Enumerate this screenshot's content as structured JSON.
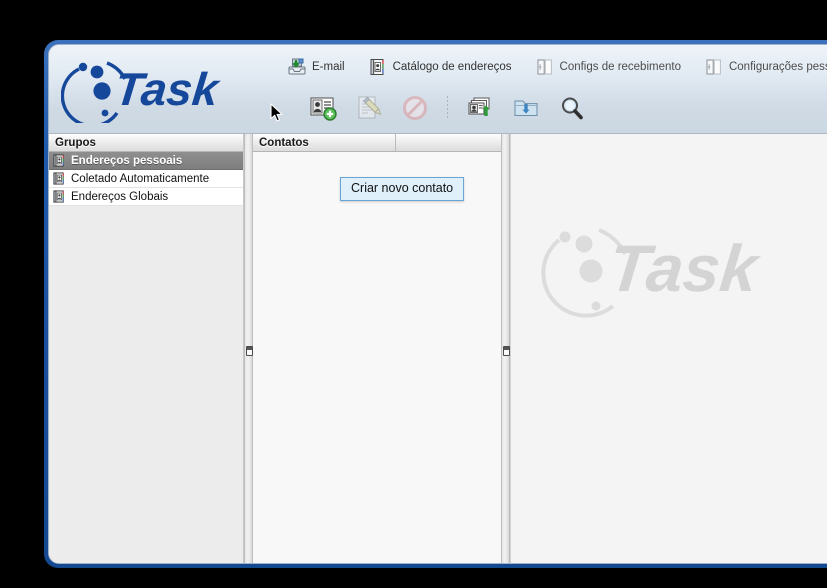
{
  "window": {
    "accent_color": "#1b4f9c",
    "brand": "Task"
  },
  "header": {
    "logo_text": "Task",
    "menu": [
      {
        "label": "E-mail",
        "icon": "inbox-download-icon",
        "state": "active"
      },
      {
        "label": "Catálogo de endereços",
        "icon": "address-book-icon",
        "state": "active"
      },
      {
        "label": "Configs de recebimento",
        "icon": "panel-icon",
        "state": "dim"
      },
      {
        "label": "Configurações pessoais",
        "icon": "panel-icon",
        "state": "dim"
      }
    ]
  },
  "toolbar": {
    "buttons": [
      {
        "name": "new-contact",
        "icon": "person-add-icon",
        "enabled": true,
        "tooltip": "Criar novo contato"
      },
      {
        "name": "edit-contact",
        "icon": "pencil-edit-icon",
        "enabled": false
      },
      {
        "name": "delete-contact",
        "icon": "prohibited-icon",
        "enabled": false
      },
      {
        "name": "import-contacts",
        "icon": "contacts-upload-icon",
        "enabled": true
      },
      {
        "name": "import-folder",
        "icon": "folder-download-icon",
        "enabled": true
      },
      {
        "name": "search",
        "icon": "magnifier-icon",
        "enabled": true
      }
    ]
  },
  "tooltip": {
    "text": "Criar novo contato",
    "background": "#dff0fb",
    "border": "#6aa3d5"
  },
  "groups_panel": {
    "header": "Grupos",
    "items": [
      {
        "label": "Endereços pessoais",
        "icon": "address-book-icon",
        "selected": true
      },
      {
        "label": "Coletado Automaticamente",
        "icon": "address-book-icon",
        "selected": false
      },
      {
        "label": "Endereços Globais",
        "icon": "address-book-icon",
        "selected": false
      }
    ]
  },
  "contacts_panel": {
    "columns": [
      "Contatos",
      ""
    ],
    "rows": []
  },
  "details_panel": {
    "watermark_text": "Task"
  }
}
